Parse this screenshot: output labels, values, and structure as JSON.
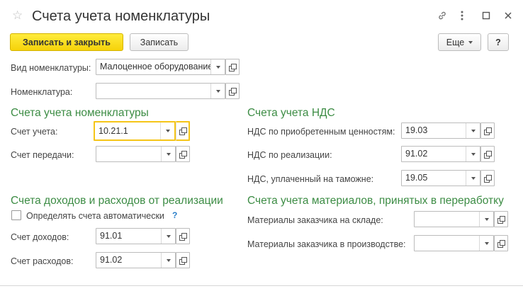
{
  "window": {
    "title": "Счета учета номенклатуры",
    "icons": [
      "star-icon",
      "link-icon",
      "more-vertical-icon",
      "maximize-icon",
      "close-icon"
    ]
  },
  "toolbar": {
    "save_close_label": "Записать и закрыть",
    "save_label": "Записать",
    "more_label": "Еще",
    "help_label": "?"
  },
  "top_fields": {
    "kind_label": "Вид номенклатуры:",
    "kind_value": "Малоценное оборудование",
    "item_label": "Номенклатура:",
    "item_value": ""
  },
  "item_accounts": {
    "header": "Счета учета номенклатуры",
    "account_label": "Счет учета:",
    "account_value": "10.21.1",
    "transfer_label": "Счет передачи:",
    "transfer_value": ""
  },
  "vat_accounts": {
    "header": "Счета учета НДС",
    "purchased_label": "НДС по приобретенным ценностям:",
    "purchased_value": "19.03",
    "sales_label": "НДС по реализации:",
    "sales_value": "91.02",
    "customs_label": "НДС, уплаченный на таможне:",
    "customs_value": "19.05"
  },
  "income_expense": {
    "header": "Счета доходов и расходов от реализации",
    "auto_checkbox_label": "Определять счета автоматически",
    "auto_checked": false,
    "help_mark": "?",
    "income_label": "Счет доходов:",
    "income_value": "91.01",
    "expense_label": "Счет расходов:",
    "expense_value": "91.02"
  },
  "materials": {
    "header": "Счета учета материалов, принятых в переработку",
    "warehouse_label": "Материалы заказчика на складе:",
    "warehouse_value": "",
    "production_label": "Материалы заказчика в производстве:",
    "production_value": ""
  }
}
